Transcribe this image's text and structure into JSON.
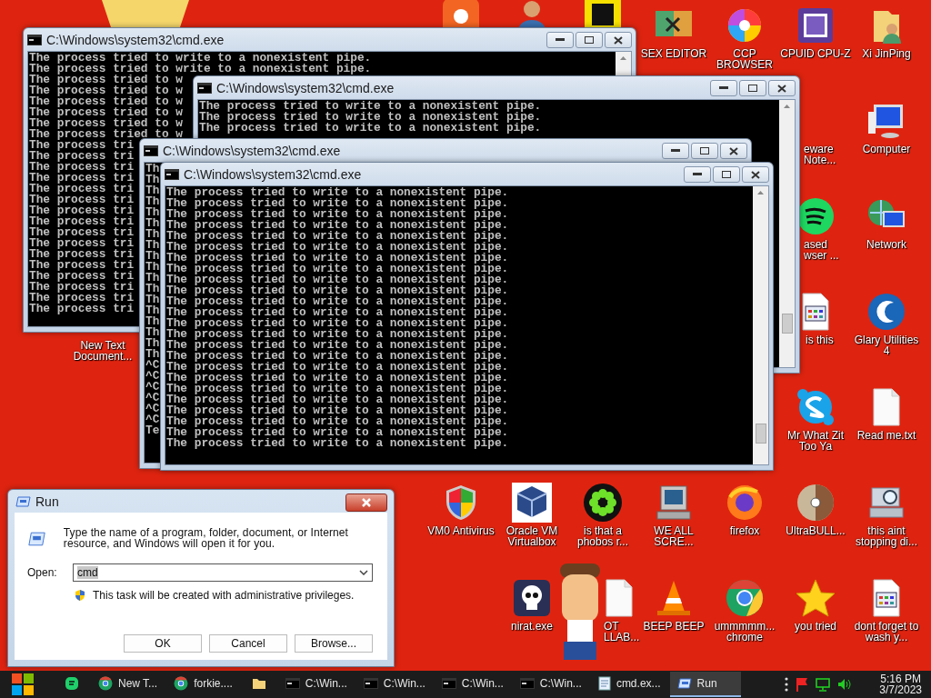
{
  "desktop_icons": [
    {
      "kind": "orange-app"
    },
    {
      "kind": "person"
    },
    {
      "kind": "yellow-app"
    },
    {
      "kind": "hex",
      "label": "SEX EDITOR"
    },
    {
      "kind": "swirl",
      "label": "CCP BROWSER"
    },
    {
      "kind": "cpu",
      "label": "CPUID CPU-Z"
    },
    {
      "kind": "user-folder",
      "label": "Xi JinPing"
    },
    {
      "kind": "none",
      "label": "eware Note..."
    },
    {
      "kind": "computer",
      "label": "Computer"
    },
    {
      "kind": "green-circle",
      "label": "ased wser ..."
    },
    {
      "kind": "network",
      "label": "Network"
    },
    {
      "kind": "none",
      "label": "New Text Document..."
    },
    {
      "kind": "grid-doc",
      "label": "is this"
    },
    {
      "kind": "glary",
      "label": "Glary Utilities 4"
    },
    {
      "kind": "chat",
      "label": "Mr What Zit Too Ya"
    },
    {
      "kind": "text-file",
      "label": "Read me.txt"
    },
    {
      "kind": "shield",
      "label": "VM0 Antivirus"
    },
    {
      "kind": "cube",
      "label": "Oracle VM Virtualbox"
    },
    {
      "kind": "petals",
      "label": "is that a phobos r..."
    },
    {
      "kind": "old-computer",
      "label": "WE ALL SCRE..."
    },
    {
      "kind": "firefox",
      "label": "firefox"
    },
    {
      "kind": "disc",
      "label": "UltraBULL..."
    },
    {
      "kind": "setup",
      "label": "this aint stopping di..."
    },
    {
      "kind": "skull",
      "label": "nirat.exe"
    },
    {
      "kind": "text-file",
      "label": "OT LLAB..."
    },
    {
      "kind": "cone",
      "label": "BEEP BEEP"
    },
    {
      "kind": "chrome",
      "label": "ummmmm... chrome"
    },
    {
      "kind": "star",
      "label": "you tried"
    },
    {
      "kind": "grid-doc",
      "label": "dont forget to wash y..."
    }
  ],
  "console_windows": [
    {
      "title": "C:\\Windows\\system32\\cmd.exe",
      "lines": [
        "The process tried to write to a nonexistent pipe.",
        "The process tried to write to a nonexistent pipe.",
        "The process tried to w",
        "The process tried to w",
        "The process tried to w",
        "The process tried to w",
        "The process tried to w",
        "The process tried to w",
        "The process tri",
        "The process tri",
        "The process tri",
        "The process tri",
        "The process tri",
        "The process tri",
        "The process tri",
        "The process tri",
        "The process tri",
        "The process tri",
        "The process tri",
        "The process tri",
        "The process tri",
        "The process tri",
        "The process tri",
        "The process tri"
      ]
    },
    {
      "title": "C:\\Windows\\system32\\cmd.exe",
      "lines": [
        "The process tried to write to a nonexistent pipe.",
        "The process tried to write to a nonexistent pipe.",
        "The process tried to write to a nonexistent pipe."
      ]
    },
    {
      "title": "C:\\Windows\\system32\\cmd.exe",
      "lines": [
        "Th",
        "Th",
        "Th",
        "Th",
        "Th",
        "Th",
        "Th",
        "Th",
        "Th",
        "Th",
        "Th",
        "Th",
        "Th",
        "Th",
        "Th",
        "Th",
        "Th",
        "Th",
        "^C",
        "^C",
        "^C",
        "^C",
        "^C",
        "^C",
        "Te"
      ]
    },
    {
      "title": "C:\\Windows\\system32\\cmd.exe",
      "lines": [
        "The process tried to write to a nonexistent pipe.",
        "The process tried to write to a nonexistent pipe.",
        "The process tried to write to a nonexistent pipe.",
        "The process tried to write to a nonexistent pipe.",
        "The process tried to write to a nonexistent pipe.",
        "The process tried to write to a nonexistent pipe.",
        "The process tried to write to a nonexistent pipe.",
        "The process tried to write to a nonexistent pipe.",
        "The process tried to write to a nonexistent pipe.",
        "The process tried to write to a nonexistent pipe.",
        "The process tried to write to a nonexistent pipe.",
        "The process tried to write to a nonexistent pipe.",
        "The process tried to write to a nonexistent pipe.",
        "The process tried to write to a nonexistent pipe.",
        "The process tried to write to a nonexistent pipe.",
        "The process tried to write to a nonexistent pipe.",
        "The process tried to write to a nonexistent pipe.",
        "The process tried to write to a nonexistent pipe.",
        "The process tried to write to a nonexistent pipe.",
        "The process tried to write to a nonexistent pipe.",
        "The process tried to write to a nonexistent pipe.",
        "The process tried to write to a nonexistent pipe.",
        "The process tried to write to a nonexistent pipe.",
        "The process tried to write to a nonexistent pipe."
      ]
    }
  ],
  "run_dialog": {
    "title": "Run",
    "description": "Type the name of a program, folder, document, or Internet resource, and Windows will open it for you.",
    "open_label": "Open:",
    "value": "cmd",
    "notice": "This task will be created with administrative privileges.",
    "buttons": [
      "OK",
      "Cancel",
      "Browse..."
    ]
  },
  "taskbar": {
    "items": [
      {
        "kind": "green-app",
        "selected": false
      },
      {
        "kind": "chrome",
        "label": "New T...",
        "selected": false
      },
      {
        "kind": "chrome",
        "label": "forkie....",
        "selected": false
      },
      {
        "kind": "folder",
        "selected": false
      },
      {
        "kind": "console",
        "label": "C:\\Win...",
        "selected": false
      },
      {
        "kind": "console",
        "label": "C:\\Win...",
        "selected": false
      },
      {
        "kind": "console",
        "label": "C:\\Win...",
        "selected": false
      },
      {
        "kind": "console",
        "label": "C:\\Win...",
        "selected": false
      },
      {
        "kind": "notepad",
        "label": "cmd.ex...",
        "selected": false
      },
      {
        "kind": "run",
        "label": "Run",
        "selected": true
      }
    ],
    "clock": {
      "time": "5:16 PM",
      "date": "3/7/2023"
    }
  }
}
